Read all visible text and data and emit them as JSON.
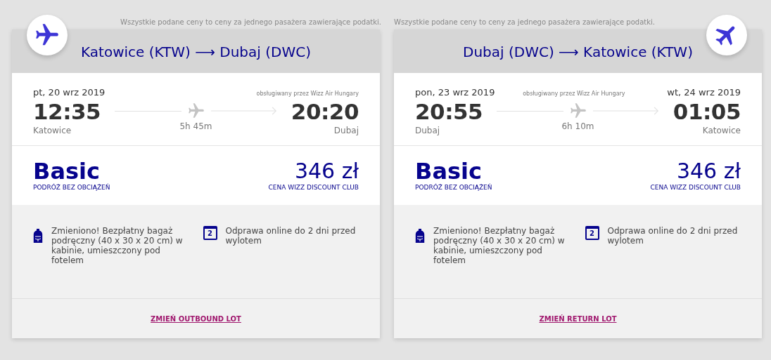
{
  "flights": [
    {
      "kind": "outbound",
      "note": "Wszystkie podane ceny to ceny za jednego pasażera zawierające podatki.",
      "route": {
        "from": "Katowice (KTW)",
        "arrow": "⟶",
        "to": "Dubaj (DWC)"
      },
      "departure": {
        "date": "pt, 20 wrz 2019",
        "time": "12:35",
        "city": "Katowice"
      },
      "operator": "obsługiwany przez Wizz Air Hungary",
      "duration": "5h 45m",
      "arrival": {
        "time": "20:20",
        "city": "Dubaj"
      },
      "fare": {
        "name": "Basic",
        "subtitle": "PODRÓŻ BEZ OBCIĄŻEŃ",
        "price": "346 zł",
        "price_note": "CENA WIZZ DISCOUNT CLUB"
      },
      "features": [
        {
          "kind": "bag",
          "text": "Zmieniono! Bezpłatny bagaż podręczny (40 x 30 x 20 cm) w kabinie, umieszczony pod fotelem"
        },
        {
          "kind": "calendar",
          "day": "2",
          "text": "Odprawa online do 2 dni przed wylotem"
        }
      ],
      "change_link": "ZMIEŃ OUTBOUND LOT"
    },
    {
      "kind": "return",
      "note": "Wszystkie podane ceny to ceny za jednego pasażera zawierające podatki.",
      "route": {
        "from": "Dubaj (DWC)",
        "arrow": "⟶",
        "to": "Katowice (KTW)"
      },
      "departure": {
        "date": "pon, 23 wrz 2019",
        "time": "20:55",
        "city": "Dubaj"
      },
      "operator": "obsługiwany przez Wizz Air Hungary",
      "duration": "6h 10m",
      "arrival": {
        "date": "wt, 24 wrz 2019",
        "time": "01:05",
        "city": "Katowice"
      },
      "fare": {
        "name": "Basic",
        "subtitle": "PODRÓŻ BEZ OBCIĄŻEŃ",
        "price": "346 zł",
        "price_note": "CENA WIZZ DISCOUNT CLUB"
      },
      "features": [
        {
          "kind": "bag",
          "text": "Zmieniono! Bezpłatny bagaż podręczny (40 x 30 x 20 cm) w kabinie, umieszczony pod fotelem"
        },
        {
          "kind": "calendar",
          "day": "2",
          "text": "Odprawa online do 2 dni przed wylotem"
        }
      ],
      "change_link": "ZMIEŃ RETURN LOT"
    }
  ]
}
